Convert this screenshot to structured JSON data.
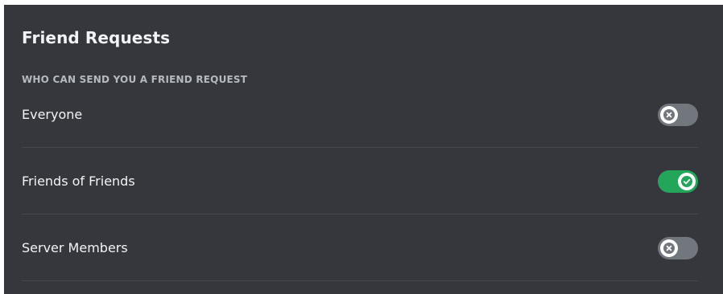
{
  "section": {
    "title": "Friend Requests",
    "subtitle": "WHO CAN SEND YOU A FRIEND REQUEST"
  },
  "options": [
    {
      "label": "Everyone",
      "enabled": false,
      "knob_icon": "x-icon"
    },
    {
      "label": "Friends of Friends",
      "enabled": true,
      "knob_icon": "check-icon"
    },
    {
      "label": "Server Members",
      "enabled": false,
      "knob_icon": "x-icon"
    }
  ],
  "colors": {
    "background": "#36373d",
    "toggle_off": "#72767d",
    "toggle_on": "#23a55a",
    "text_primary": "#f2f3f5",
    "text_secondary": "#b5bac1"
  }
}
